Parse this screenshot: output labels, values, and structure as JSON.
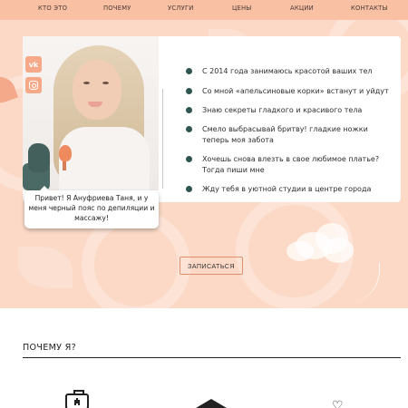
{
  "nav": {
    "items": [
      {
        "label": "КТО ЭТО"
      },
      {
        "label": "ПОЧЕМУ"
      },
      {
        "label": "УСЛУГИ"
      },
      {
        "label": "ЦЕНЫ"
      },
      {
        "label": "АКЦИИ"
      },
      {
        "label": "КОНТАКТЫ"
      }
    ]
  },
  "hero": {
    "social": {
      "vk_label": "vk",
      "vk_icon": "vk-icon",
      "ig_icon": "instagram-icon"
    },
    "speech": "Привет! Я Ануфриева Таня, и у меня черный пояс по депиляции и массажу!",
    "bullets": [
      "С 2014 года занимаюсь красотой ваших тел",
      "Со мной «апельсиновые корки» встанут и уйдут",
      "Знаю секреты гладкого и красивого тела",
      "Смело выбрасывай бритву! гладкие ножки теперь моя забота",
      "Хочешь снова влезть в свое любимое платье? Тогда пиши мне",
      "Жду тебя в уютной студии в центре города"
    ],
    "cta": "ЗАПИСАТЬСЯ"
  },
  "why": {
    "title": "ПОЧЕМУ Я?",
    "icons": [
      "briefcase-icon",
      "graduation-cap-icon",
      "heart-icon"
    ]
  },
  "colors": {
    "nav_bg": "#f9c0a3",
    "hero_bg": "#fbd9c6",
    "accent": "#f5a989",
    "bullet": "#2f5550"
  }
}
